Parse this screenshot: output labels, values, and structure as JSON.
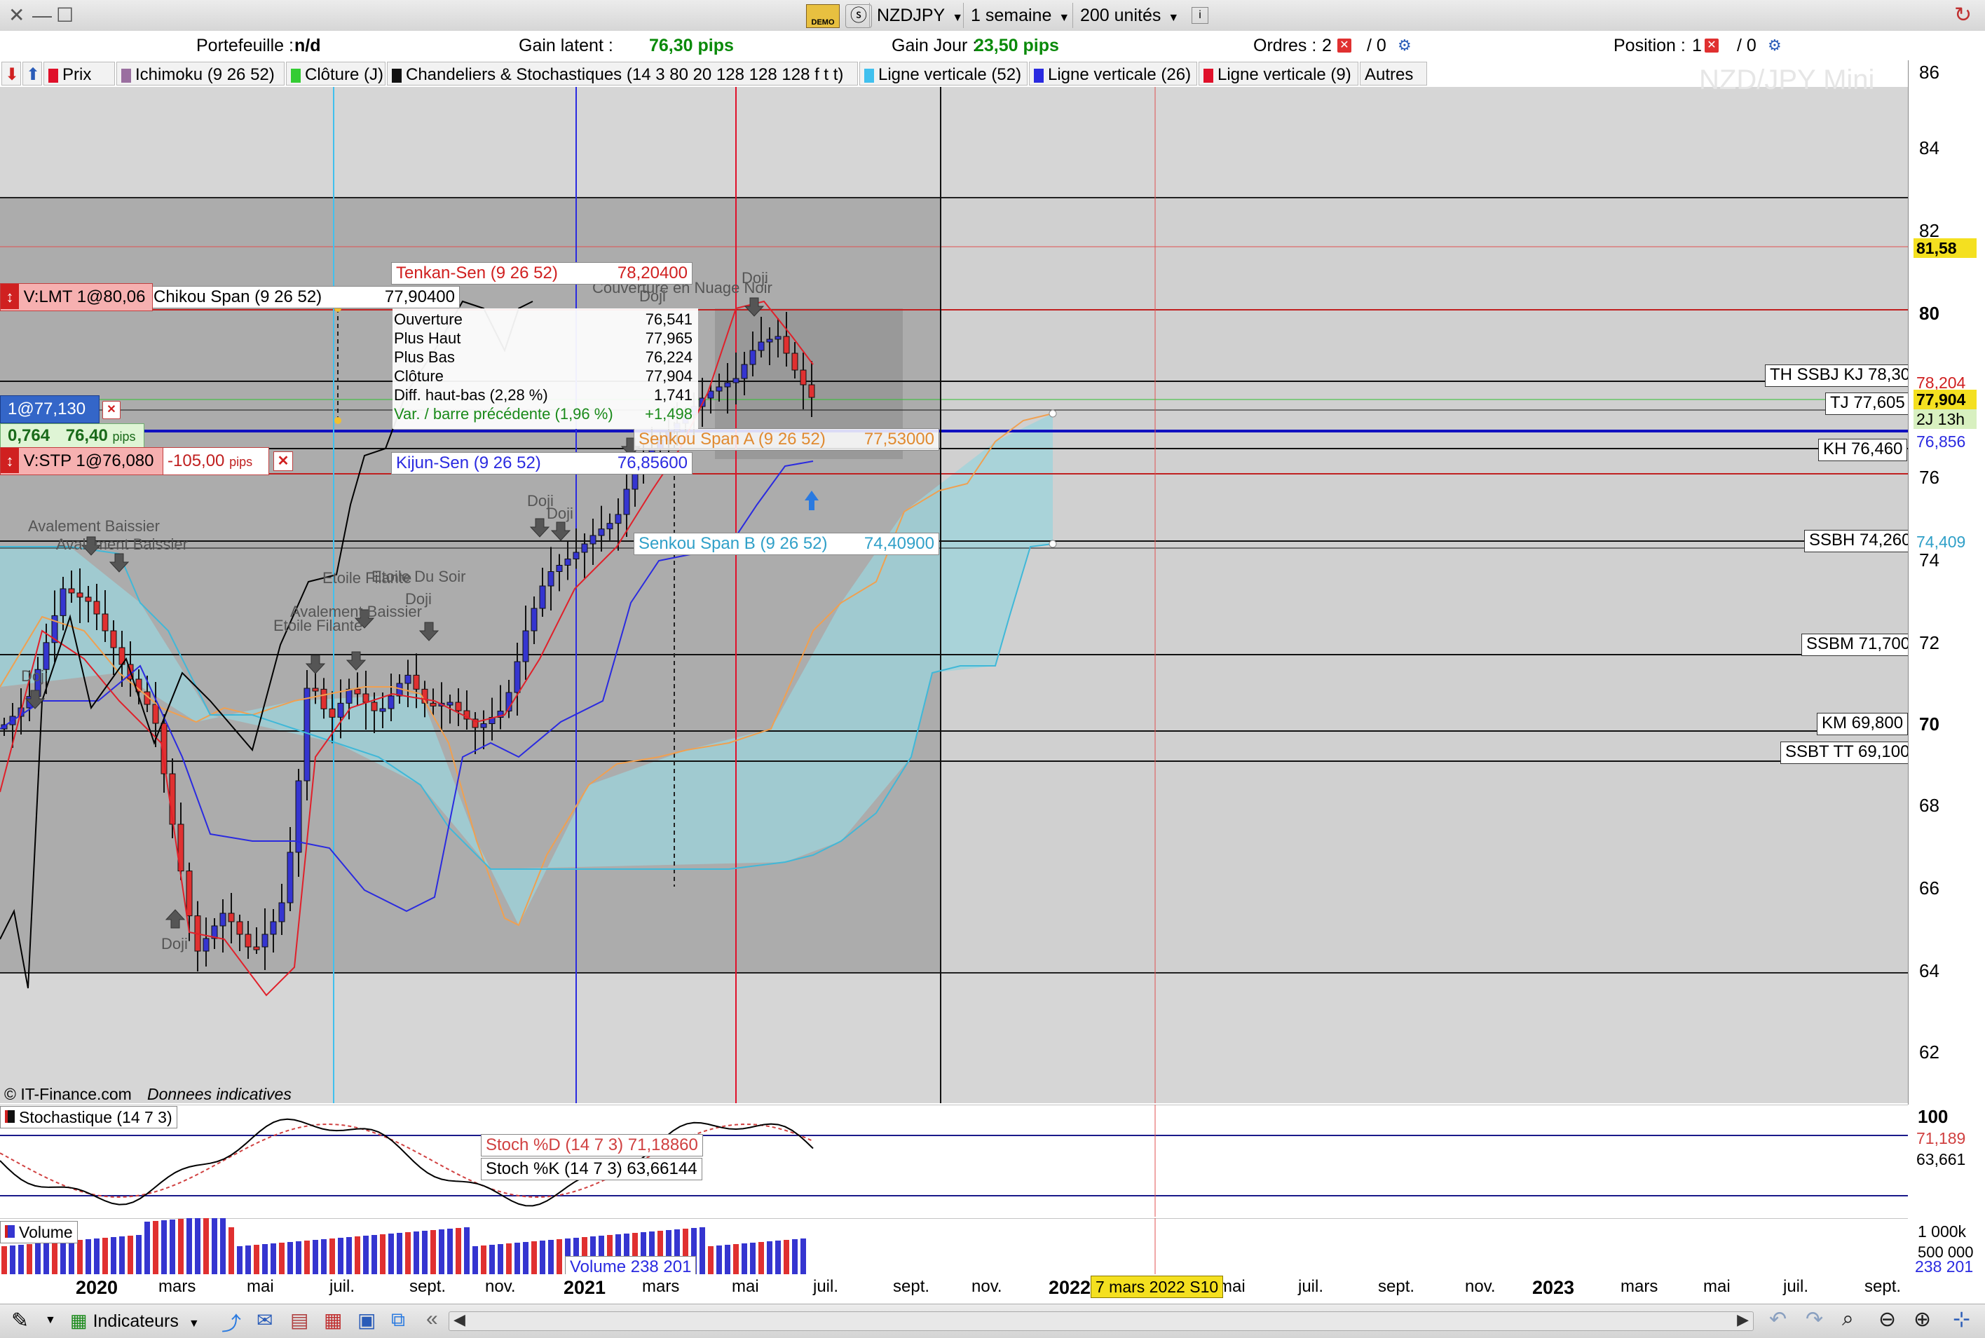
{
  "window": {
    "close_glyph": "✕",
    "minimize_glyph": "—",
    "maximize_glyph": "☐",
    "demo_badge": "DEMO",
    "symbol": "NZDJPY",
    "timeframe": "1 semaine",
    "units": "200 unités"
  },
  "infobar": {
    "portfolio_label": "Portefeuille :",
    "portfolio_value": "n/d",
    "latent_label": "Gain latent :",
    "latent_value": "76,30 pips",
    "day_label": "Gain Jour :",
    "day_value": "23,50 pips",
    "orders_label": "Ordres :",
    "orders_count": "2",
    "orders_sep": "/ 0",
    "position_label": "Position :",
    "position_count": "1",
    "position_sep": "/ 0"
  },
  "tabs": [
    {
      "label": "Prix",
      "color": "#e0102a"
    },
    {
      "label": "Ichimoku (9 26 52)",
      "color": "#9a6fa0"
    },
    {
      "label": "Clôture (J)",
      "color": "#33cc33"
    },
    {
      "label": "Chandeliers & Stochastiques (14 3 80 20 128 128 128 f t t)",
      "color": "#111111"
    },
    {
      "label": "Ligne verticale (52)",
      "color": "#40c0ee"
    },
    {
      "label": "Ligne verticale (26)",
      "color": "#2a2ae0"
    },
    {
      "label": "Ligne verticale (9)",
      "color": "#e0102a"
    },
    {
      "label": "Autres",
      "color": ""
    }
  ],
  "chart": {
    "watermark": "NZD/JPY Mini",
    "copyright": "© IT-Finance.com",
    "disclaimer": "Donnees indicatives",
    "y_ticks": [
      "86",
      "84",
      "82",
      "80",
      "78",
      "76",
      "74",
      "72",
      "70",
      "68",
      "66",
      "64",
      "62"
    ],
    "right_labels": {
      "price_81": "81,58",
      "tenkan": "78,204",
      "close": "77,904",
      "countdown": "2J 13h",
      "kijun": "76,856",
      "ssb": "74,409"
    },
    "levels": [
      {
        "label": "TH SSBJ KJ 78,300"
      },
      {
        "label": "TJ 77,605"
      },
      {
        "label": "KH 76,460"
      },
      {
        "label": "SSBH 74,260"
      },
      {
        "label": "SSBM 71,700"
      },
      {
        "label": "KM 69,800"
      },
      {
        "label": "SSBT TT 69,100"
      }
    ],
    "indicator_labels": {
      "tenkan_name": "Tenkan-Sen (9 26 52)",
      "tenkan_value": "78,20400",
      "chikou_name": "Chikou Span (9 26 52)",
      "chikou_value": "77,90400",
      "kijun_name": "Kijun-Sen (9 26 52)",
      "kijun_value": "76,85600",
      "ssa_name": "Senkou Span A (9 26 52)",
      "ssa_value": "77,53000",
      "ssb_name": "Senkou Span B (9 26 52)",
      "ssb_value": "74,40900"
    },
    "ohlc": [
      {
        "label": "Ouverture",
        "value": "76,541"
      },
      {
        "label": "Plus Haut",
        "value": "77,965"
      },
      {
        "label": "Plus Bas",
        "value": "76,224"
      },
      {
        "label": "Clôture",
        "value": "77,904"
      },
      {
        "label": "Diff. haut-bas (2,28 %)",
        "value": "1,741"
      },
      {
        "label": "Var. / barre précédente (1,96 %)",
        "value": "+1,498"
      }
    ],
    "orders": {
      "limit_label": "V:LMT  1@80,06",
      "entry_label": "1@77,130",
      "entry_gain": "0,764",
      "entry_pips": "76,40",
      "pips_unit": "pips",
      "stop_label": "V:STP  1@76,080",
      "stop_pips": "-105,00",
      "stop_unit": "pips",
      "close_glyph": "✕"
    },
    "patterns": [
      "Avalement Baissier",
      "Avalement Baissier",
      "Doji",
      "Doji",
      "Etoile Filante",
      "Etoile Du Soir",
      "Etoile Filante",
      "Avalement Baissier",
      "Doji",
      "Doji",
      "Doji",
      "Doji",
      "Couverture en Nuage Noir",
      "Doji"
    ]
  },
  "stoch": {
    "panel_label": "Stochastique (14 7 3)",
    "d_label": "Stoch %D (14 7 3)  71,18860",
    "k_label": "Stoch %K (14 7 3)  63,66144",
    "y_top": "100",
    "right_d": "71,189",
    "right_k": "63,661"
  },
  "volume": {
    "panel_label": "Volume",
    "value_label": "Volume  238 201",
    "y_top": "1 000k",
    "y_mid": "500 000",
    "right_value": "238 201"
  },
  "xaxis": {
    "labels": [
      {
        "text": "2020",
        "bold": true
      },
      {
        "text": "mars"
      },
      {
        "text": "mai"
      },
      {
        "text": "juil."
      },
      {
        "text": "sept."
      },
      {
        "text": "nov."
      },
      {
        "text": "2021",
        "bold": true
      },
      {
        "text": "mars"
      },
      {
        "text": "mai"
      },
      {
        "text": "juil."
      },
      {
        "text": "sept."
      },
      {
        "text": "nov."
      },
      {
        "text": "2022",
        "bold": true
      },
      {
        "text": "mai"
      },
      {
        "text": "juil."
      },
      {
        "text": "sept."
      },
      {
        "text": "nov."
      },
      {
        "text": "2023",
        "bold": true
      },
      {
        "text": "mars"
      },
      {
        "text": "mai"
      },
      {
        "text": "juil."
      },
      {
        "text": "sept."
      }
    ],
    "cursor_date": "7 mars 2022 S10"
  },
  "bottombar": {
    "indicators_label": "Indicateurs",
    "collapse_glyph": "«"
  },
  "colors": {
    "tenkan": "#e0202a",
    "kijun": "#2a2ae0",
    "chikou": "#000000",
    "ssa": "#f0a050",
    "ssb": "#40b8d8",
    "cloud": "#9cd4dc",
    "bull": "#3535d0",
    "bear": "#e03030"
  }
}
